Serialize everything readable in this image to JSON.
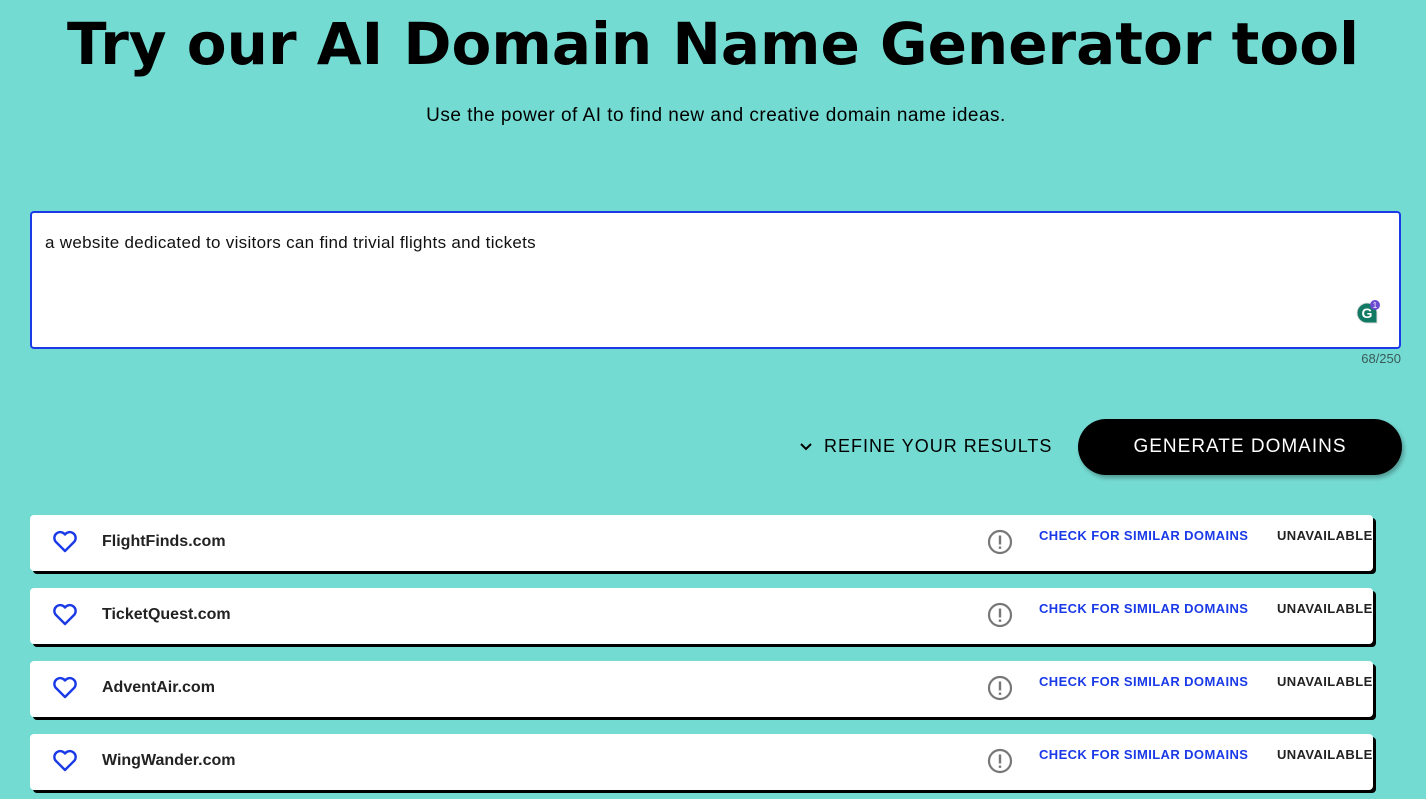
{
  "header": {
    "title": "Try our AI Domain Name Generator tool",
    "subtitle": "Use the power of AI to find new and creative domain name ideas."
  },
  "input": {
    "value": "a website dedicated to visitors can find trivial flights and tickets",
    "count": "68/250",
    "grammarly_badge": "1"
  },
  "actions": {
    "refine_label": "REFINE YOUR RESULTS",
    "generate_label": "GENERATE DOMAINS"
  },
  "colors": {
    "background": "#74dbd3",
    "accent": "#1a3ae8"
  },
  "results": [
    {
      "name": "FlightFinds.com",
      "check": "CHECK FOR SIMILAR DOMAINS",
      "status": "UNAVAILABLE"
    },
    {
      "name": "TicketQuest.com",
      "check": "CHECK FOR SIMILAR DOMAINS",
      "status": "UNAVAILABLE"
    },
    {
      "name": "AdventAir.com",
      "check": "CHECK FOR SIMILAR DOMAINS",
      "status": "UNAVAILABLE"
    },
    {
      "name": "WingWander.com",
      "check": "CHECK FOR SIMILAR DOMAINS",
      "status": "UNAVAILABLE"
    }
  ]
}
